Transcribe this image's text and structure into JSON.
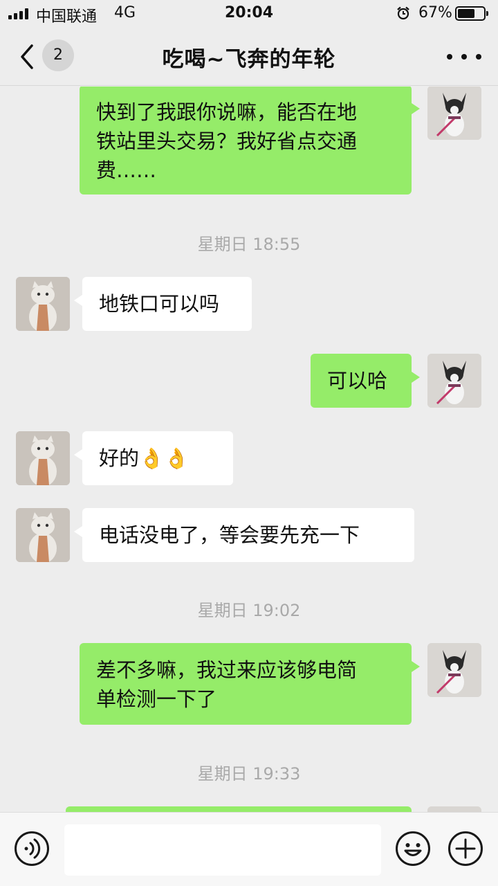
{
  "status_bar": {
    "carrier": "中国联通",
    "network": "4G",
    "time": "20:04",
    "battery_percent": "67%",
    "battery_level": 0.67
  },
  "nav": {
    "unread_count": "2",
    "title": "吃喝~飞奔的年轮"
  },
  "messages": [
    {
      "side": "right",
      "text": "快到了我跟你说嘛，能否在地\n铁站里头交易？我好省点交通\n费……"
    },
    {
      "type": "time",
      "text": "星期日 18:55"
    },
    {
      "side": "left",
      "text": "地铁口可以吗"
    },
    {
      "side": "right",
      "text": "可以哈"
    },
    {
      "side": "left",
      "text": "好的👌👌"
    },
    {
      "side": "left",
      "text": "电话没电了，等会要先充一下"
    },
    {
      "type": "time",
      "text": "星期日 19:02"
    },
    {
      "side": "right",
      "text": "差不多嘛，我过来应该够电简\n单检测一下了"
    },
    {
      "type": "time",
      "text": "星期日 19:33"
    }
  ],
  "input": {
    "value": "",
    "placeholder": ""
  },
  "colors": {
    "outgoing_bubble": "#95ec69",
    "incoming_bubble": "#ffffff",
    "background": "#ededed"
  },
  "icons": {
    "back": "chevron-left-icon",
    "more": "more-dots-icon",
    "voice": "voice-icon",
    "emoji": "emoji-icon",
    "add": "plus-circle-icon"
  }
}
